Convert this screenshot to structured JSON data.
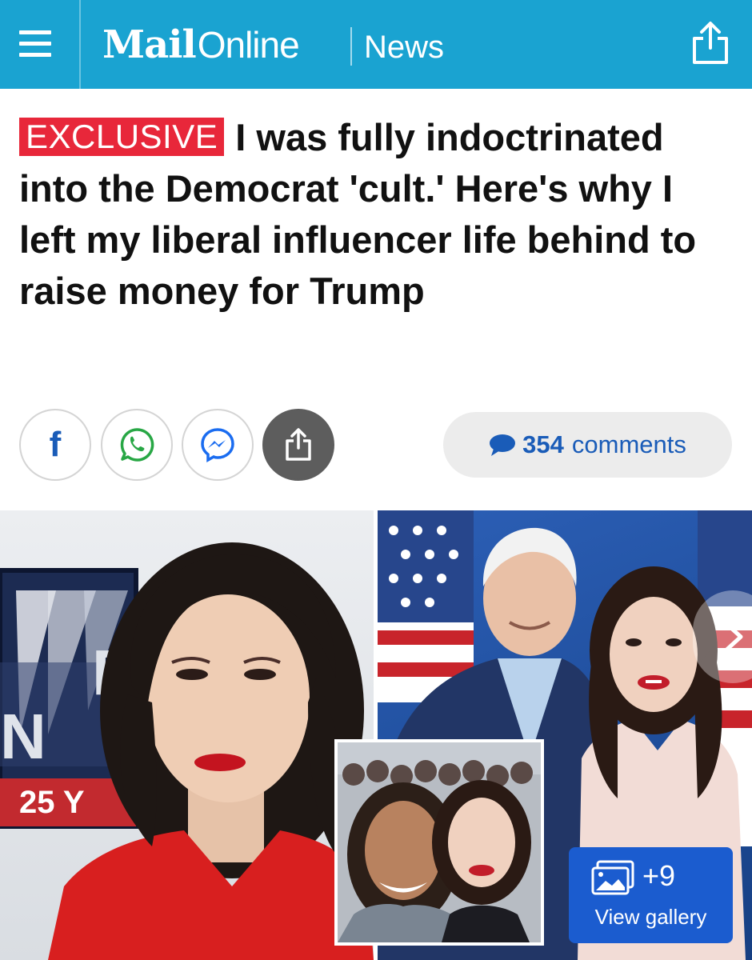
{
  "header": {
    "logo_mail": "Mail",
    "logo_online": "Online",
    "section": "News",
    "brand_color": "#1aa3d1"
  },
  "article": {
    "badge": "EXCLUSIVE",
    "badge_color": "#e8273a",
    "headline": "I was fully indoctrinated into the Democrat 'cult.' Here's why I left my liberal influencer life behind to raise money for Trump"
  },
  "social": {
    "facebook_glyph": "f",
    "icons": [
      "facebook-icon",
      "whatsapp-icon",
      "messenger-icon",
      "share-icon"
    ]
  },
  "comments": {
    "count": "354",
    "label": "comments",
    "color": "#1a5cb8"
  },
  "gallery": {
    "count": "+9",
    "label": "View gallery",
    "color": "#1b5ccf"
  },
  "photo_signage": {
    "left_sign_text": "25 Y"
  }
}
